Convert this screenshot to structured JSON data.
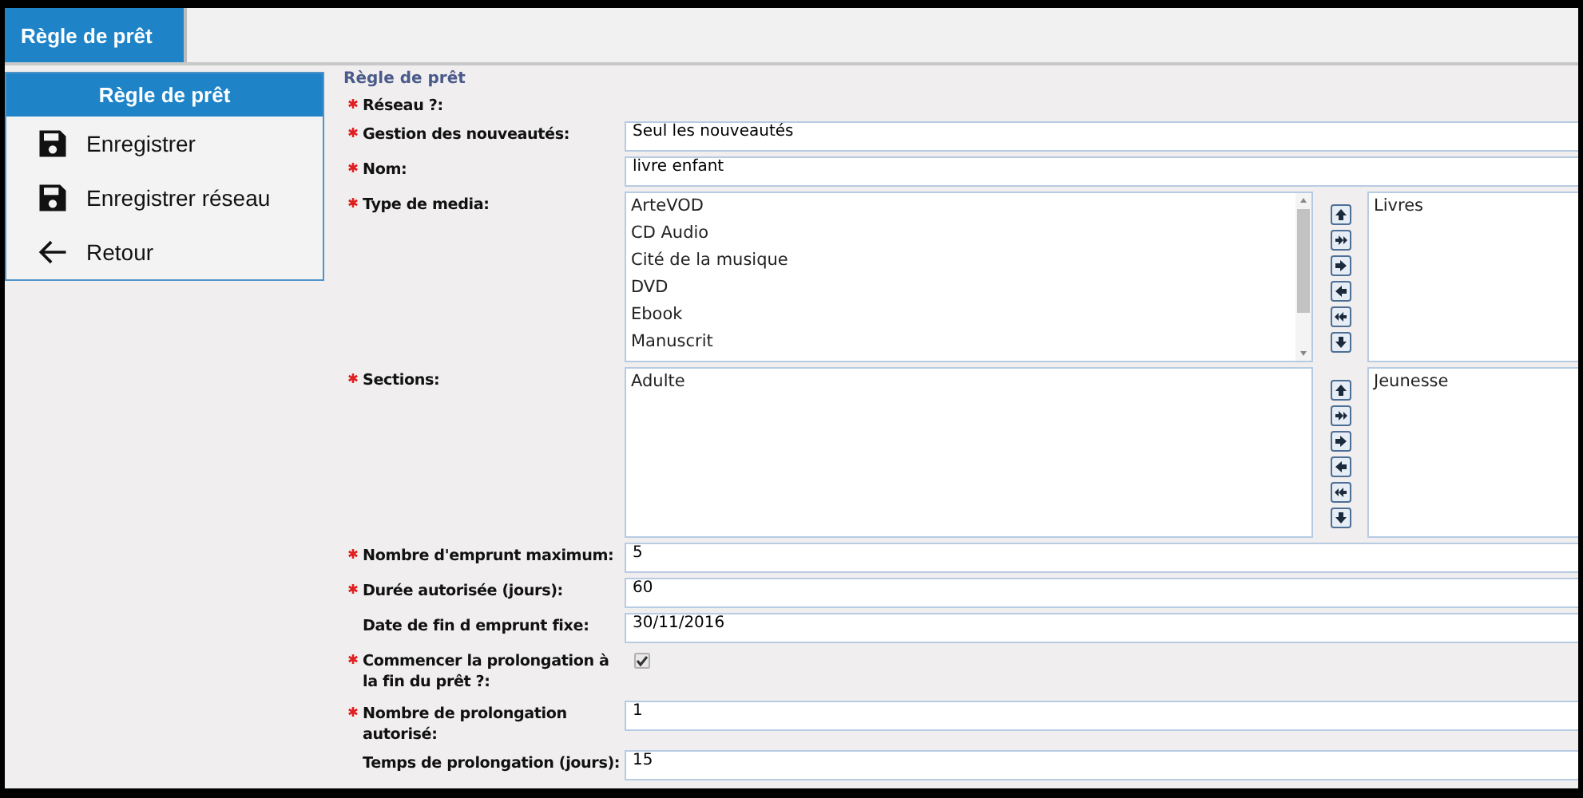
{
  "tabs": [
    {
      "label": "Règle de prêt",
      "selected": true
    }
  ],
  "sidebar": {
    "title": "Règle de prêt",
    "items": [
      {
        "label": "Enregistrer",
        "kind": "save"
      },
      {
        "label": "Enregistrer réseau",
        "kind": "save"
      },
      {
        "label": "Retour",
        "kind": "back"
      }
    ]
  },
  "form": {
    "title": "Règle de prêt",
    "fields": [
      {
        "label": "Réseau ?:",
        "required": true,
        "kind": "none"
      },
      {
        "label": "Gestion des nouveautés:",
        "required": true,
        "kind": "text",
        "value": "Seul les nouveautés"
      },
      {
        "label": "Nom:",
        "required": true,
        "kind": "text",
        "value": "livre enfant"
      },
      {
        "label": "Type de media:",
        "required": true,
        "kind": "listpair",
        "available": [
          "ArteVOD",
          "CD Audio",
          "Cité de la musique",
          "DVD",
          "Ebook",
          "Manuscrit"
        ],
        "chosen": [
          "Livres"
        ]
      },
      {
        "label": "Sections:",
        "required": true,
        "kind": "listpair",
        "available": [
          "Adulte"
        ],
        "chosen": [
          "Jeunesse"
        ]
      },
      {
        "label": "Nombre d'emprunt maximum:",
        "required": true,
        "kind": "text",
        "value": "5"
      },
      {
        "label": "Durée autorisée (jours):",
        "required": true,
        "kind": "text",
        "value": "60"
      },
      {
        "label": "Date de fin d emprunt fixe:",
        "required": false,
        "kind": "text",
        "value": "30/11/2016"
      },
      {
        "label": "Commencer la prolongation à la fin du prêt ?:",
        "required": true,
        "kind": "checkbox",
        "checked": true
      },
      {
        "label": "Nombre de prolongation autorisé:",
        "required": true,
        "kind": "text",
        "value": "1"
      },
      {
        "label": "Temps de prolongation (jours):",
        "required": false,
        "kind": "text",
        "value": "15"
      }
    ]
  }
}
